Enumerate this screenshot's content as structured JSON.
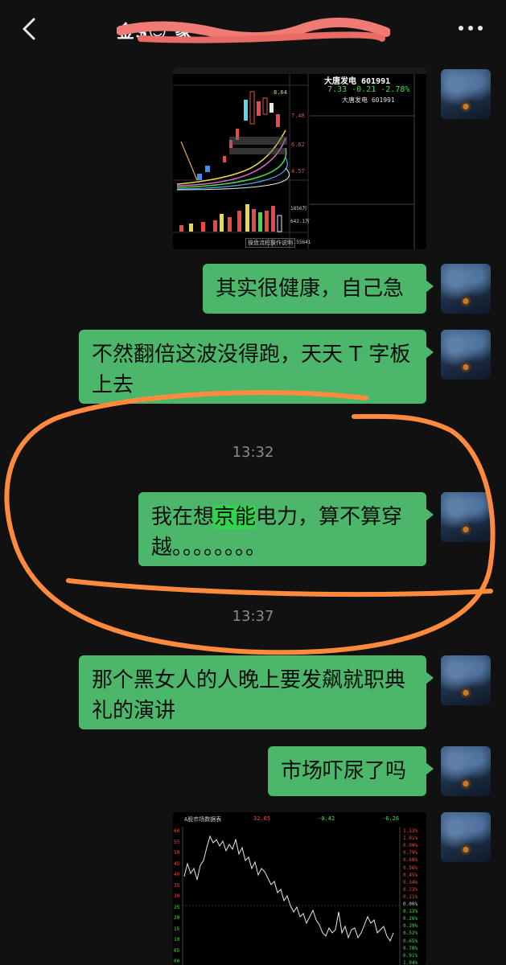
{
  "header": {
    "title": "金$😎 象",
    "more_icon": "ellipsis-horizontal-icon",
    "back_icon": "chevron-left-icon"
  },
  "messages": {
    "m1_image": {
      "stock_name": "大唐发电 601991",
      "stock_name2": "大唐发电 601991",
      "price": "7.33",
      "change": "-0.21",
      "change_pct": "-2.78%",
      "price_high": "8.64",
      "axis": [
        "7.48",
        "6.62",
        "4.57"
      ],
      "vol_axis": [
        "1856万",
        "642.1万",
        "-155641"
      ],
      "bottom_tabs": [
        "操盘流程",
        "操作说明"
      ]
    },
    "m2": "其实很健康，自己急",
    "m3": "不然翻倍这波没得跑，天天 T 字板上去",
    "time1": "13:32",
    "m4_before": "我在想",
    "m4_highlight": "京能",
    "m4_after": "电力，算不算穿越。。。。。。。。",
    "time2": "13:37",
    "m5": "那个黑女人的人晚上要发飙就职典礼的演讲",
    "m6": "市场吓尿了吗",
    "m7_image": {
      "title": "A股市场数据表",
      "top_values": [
        "32.05",
        "-0.42",
        "-6.26"
      ],
      "left_axis": [
        "60",
        "55",
        "50",
        "45",
        "40",
        "35",
        "30",
        "25",
        "20",
        "15",
        "10",
        "05",
        "00"
      ],
      "right_axis": [
        "1.13%",
        "1.01%",
        "0.90%",
        "0.79%",
        "0.68%",
        "0.56%",
        "0.45%",
        "0.34%",
        "0.23%",
        "0.11%",
        "0.00%",
        "0.13%",
        "0.26%",
        "0.39%",
        "0.52%",
        "0.65%",
        "0.78%",
        "0.91%",
        "1.04%"
      ]
    }
  },
  "colors": {
    "bubble": "#4cb66a",
    "background": "#111111",
    "annotation": "#ff8a3d"
  }
}
